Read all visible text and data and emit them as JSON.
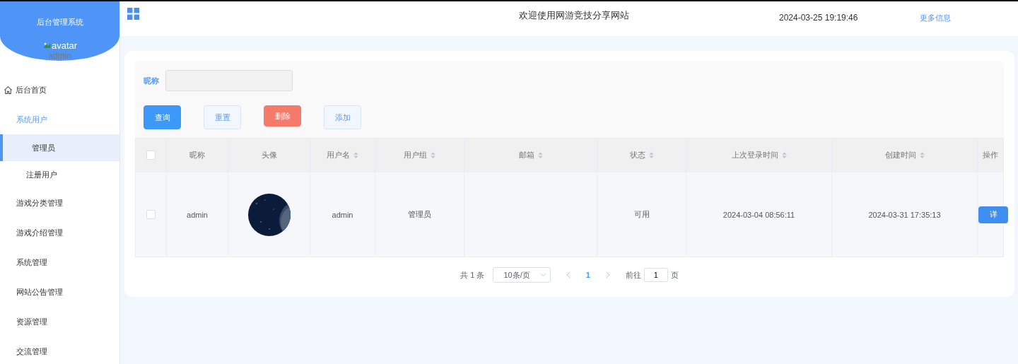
{
  "sidebar": {
    "title": "后台管理系统",
    "avatar_alt": "avatar",
    "username": "admin",
    "items": [
      {
        "label": "后台首页",
        "kind": "home",
        "selected": false
      },
      {
        "label": "系统用户",
        "kind": "group",
        "expanded": true,
        "children": [
          {
            "label": "管理员",
            "selected": true
          },
          {
            "label": "注册用户",
            "selected": false
          }
        ]
      },
      {
        "label": "游戏分类管理",
        "kind": "item",
        "selected": false
      },
      {
        "label": "游戏介绍管理",
        "kind": "item",
        "selected": false
      },
      {
        "label": "系统管理",
        "kind": "item",
        "selected": false
      },
      {
        "label": "网站公告管理",
        "kind": "item",
        "selected": false
      },
      {
        "label": "资源管理",
        "kind": "item",
        "selected": false
      },
      {
        "label": "交流管理",
        "kind": "item",
        "selected": false
      }
    ]
  },
  "header": {
    "title": "欢迎使用网游竞技分享网站",
    "datetime": "2024-03-25 19:19:46",
    "more_link": "更多信息"
  },
  "search": {
    "label": "昵称"
  },
  "buttons": [
    {
      "label": "查询",
      "kind": "primary"
    },
    {
      "label": "重置",
      "kind": "plain"
    },
    {
      "label": "删除",
      "kind": "danger"
    },
    {
      "label": "添加",
      "kind": "plain"
    }
  ],
  "table": {
    "columns": [
      {
        "kind": "check",
        "checked": false
      },
      {
        "label": "昵称",
        "sortable": false
      },
      {
        "label": "头像",
        "sortable": false
      },
      {
        "label": "用户名",
        "sortable": true
      },
      {
        "label": "用户组",
        "sortable": true
      },
      {
        "label": "邮箱",
        "sortable": true
      },
      {
        "label": "状态",
        "sortable": true
      },
      {
        "label": "上次登录时间",
        "sortable": true
      },
      {
        "label": "创建时间",
        "sortable": true
      },
      {
        "label": "操作",
        "sortable": false
      }
    ],
    "rows": [
      {
        "checked": false,
        "nickname": "admin",
        "username": "admin",
        "group": "管理员",
        "status": "可用",
        "last_login": "2024-03-04 08:56:11",
        "created": "2024-03-31 17:35:13",
        "action": "详"
      }
    ]
  },
  "pagination": {
    "total": "共 1 条",
    "page_size": "10条/页",
    "pages": [
      {
        "label": "1",
        "selected": true
      }
    ],
    "goto_label": "前往",
    "goto_value": "1",
    "goto_suffix": "页"
  }
}
